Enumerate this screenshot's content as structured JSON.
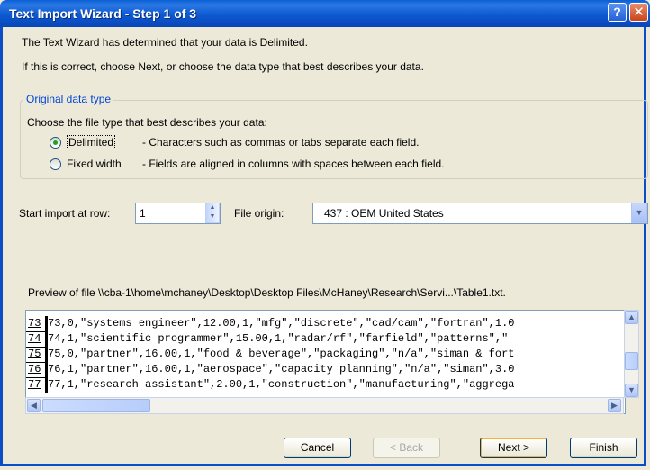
{
  "window": {
    "title": "Text Import Wizard - Step 1 of 3",
    "help_glyph": "?",
    "close_glyph": "✕"
  },
  "intro": {
    "line1": "The Text Wizard has determined that your data is Delimited.",
    "line2": "If this is correct, choose Next, or choose the data type that best describes your data."
  },
  "original_data_type": {
    "legend": "Original data type",
    "prompt": "Choose the file type that best describes your data:",
    "options": [
      {
        "label": "Delimited",
        "description": "- Characters such as commas or tabs separate each field.",
        "selected": true
      },
      {
        "label": "Fixed width",
        "description": "- Fields are aligned in columns with spaces between each field.",
        "selected": false
      }
    ]
  },
  "import_settings": {
    "start_row_label": "Start import at row:",
    "start_row_value": "1",
    "file_origin_label": "File origin:",
    "file_origin_value": "437 : OEM United States"
  },
  "preview": {
    "label": "Preview of file \\\\cba-1\\home\\mchaney\\Desktop\\Desktop Files\\McHaney\\Research\\Servi...\\Table1.txt.",
    "rows": [
      {
        "num": "73",
        "text": "73,0,\"systems engineer\",12.00,1,\"mfg\",\"discrete\",\"cad/cam\",\"fortran\",1.0"
      },
      {
        "num": "74",
        "text": "74,1,\"scientific programmer\",15.00,1,\"radar/rf\",\"farfield\",\"patterns\",\""
      },
      {
        "num": "75",
        "text": "75,0,\"partner\",16.00,1,\"food & beverage\",\"packaging\",\"n/a\",\"siman & fort"
      },
      {
        "num": "76",
        "text": "76,1,\"partner\",16.00,1,\"aerospace\",\"capacity planning\",\"n/a\",\"siman\",3.0"
      },
      {
        "num": "77",
        "text": "77,1,\"research assistant\",2.00,1,\"construction\",\"manufacturing\",\"aggrega"
      }
    ]
  },
  "buttons": {
    "cancel": "Cancel",
    "back": "< Back",
    "next": "Next >",
    "finish": "Finish"
  },
  "colors": {
    "titlebar": "#0a5fd6",
    "dialog_bg": "#ece9d8",
    "legend_text": "#0046d5",
    "radio_dot": "#21a121"
  }
}
